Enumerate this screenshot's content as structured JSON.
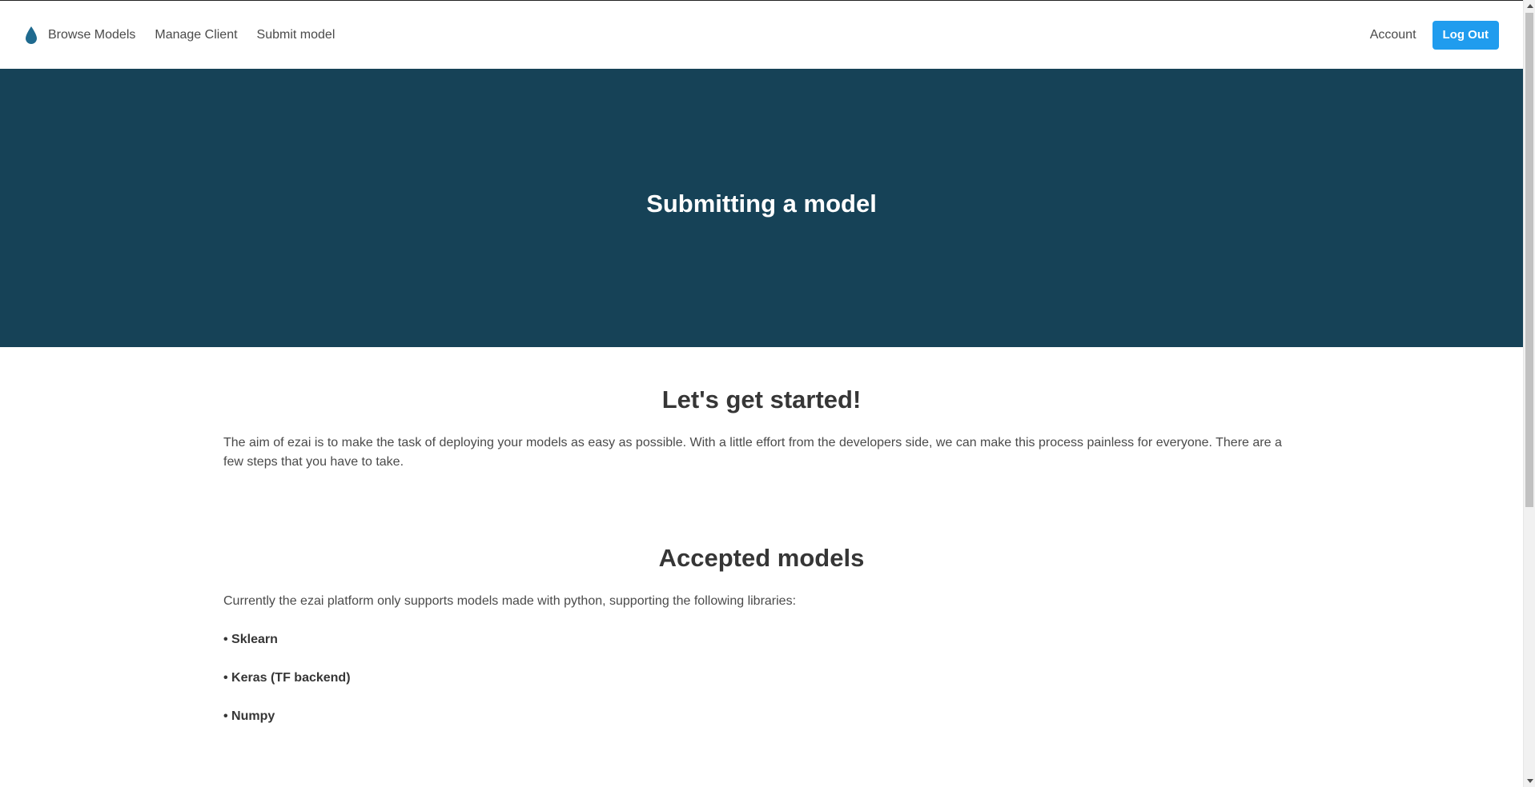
{
  "nav": {
    "logo_icon": "droplet-icon",
    "brand_color": "#1f6a8f",
    "links": [
      "Browse Models",
      "Manage Client",
      "Submit model"
    ],
    "account_label": "Account",
    "logout_label": "Log Out",
    "logout_color": "#209cee"
  },
  "hero": {
    "title": "Submitting a model",
    "background": "#164257"
  },
  "intro": {
    "title": "Let's get started!",
    "text": "The aim of ezai is to make the task of deploying your models as easy as possible. With a little effort from the developers side, we can make this process painless for everyone. There are a few steps that you have to take."
  },
  "accepted": {
    "title": "Accepted models",
    "text": "Currently the ezai platform only supports models made with python, supporting the following libraries:",
    "libraries": [
      "• Sklearn",
      "• Keras (TF backend)",
      "• Numpy"
    ]
  }
}
